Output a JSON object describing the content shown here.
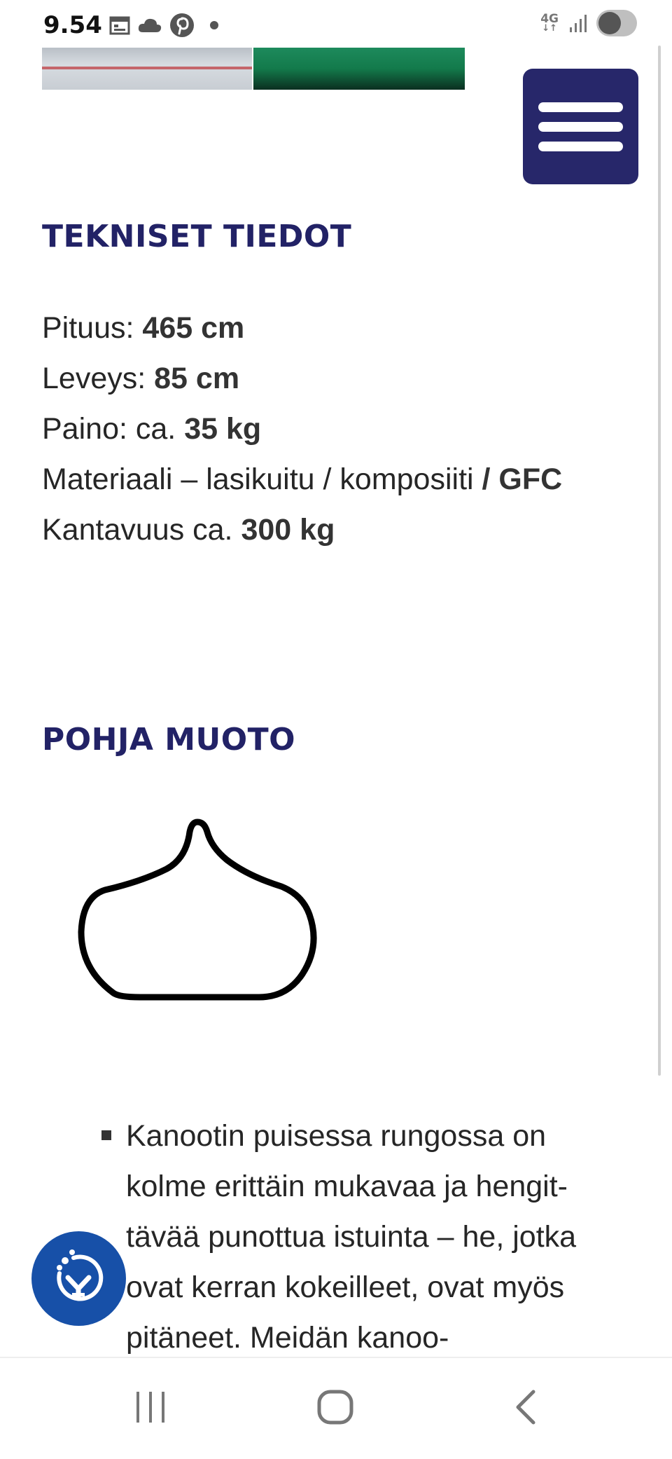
{
  "status_bar": {
    "time": "9.54",
    "network": "4G",
    "icons": [
      "calendar-icon",
      "cloud-icon",
      "pinterest-icon",
      "dot-icon",
      "signal-icon",
      "toggle-icon"
    ]
  },
  "menu": {
    "icon": "hamburger-menu-icon",
    "color": "#27276A"
  },
  "sections": {
    "specs_title": "TEKNISET TIEDOT",
    "shape_title": "POHJA MUOTO"
  },
  "specs": [
    {
      "label": "Pituus: ",
      "value": "465 cm"
    },
    {
      "label": "Leveys: ",
      "value": "85 cm"
    },
    {
      "label": "Paino: ca. ",
      "value": "35 kg"
    },
    {
      "label": "Materiaali – lasikuitu / komposiiti ",
      "value": "/ GFC"
    },
    {
      "label": "Kantavuus ca. ",
      "value": "300 kg"
    }
  ],
  "bullet_text": "Kanootin puisessa rungossa on kolme erittäin mukavaa ja hengit-tävää punottua istuinta – he, jotka ovat kerran kokeilleet, ovat myös pitäneet. Meidän kanoo-",
  "accessibility": {
    "icon": "accessibility-icon",
    "color": "#1750A8"
  },
  "nav": {
    "icons": [
      "recent-apps-icon",
      "home-icon",
      "back-icon"
    ]
  },
  "colors": {
    "heading": "#222266",
    "text": "#262626"
  }
}
